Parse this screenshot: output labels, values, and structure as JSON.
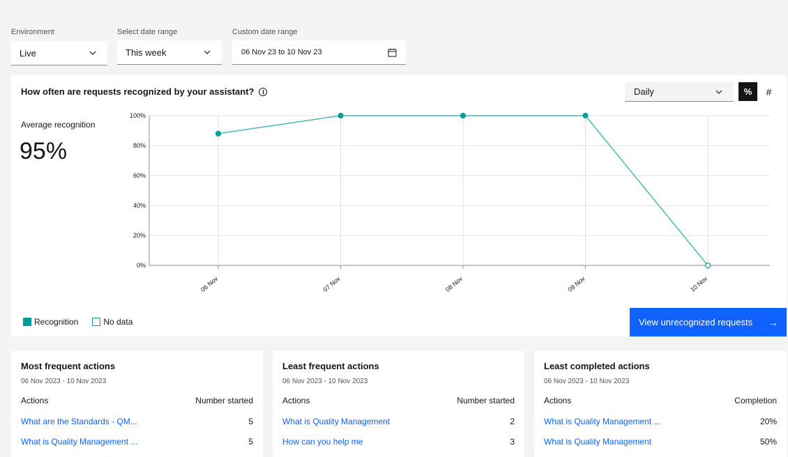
{
  "filters": {
    "environment_label": "Environment",
    "environment_value": "Live",
    "date_range_label": "Select date range",
    "date_range_value": "This week",
    "custom_label": "Custom date range",
    "custom_value": "06 Nov 23 to 10 Nov 23"
  },
  "recognition": {
    "title": "How often are requests recognized by your assistant?",
    "period": "Daily",
    "toggle_percent": "%",
    "toggle_count": "#",
    "avg_label": "Average recognition",
    "avg_value": "95%",
    "legend_recognition": "Recognition",
    "legend_nodata": "No data",
    "view_button": "View unrecognized requests",
    "arrow": "→"
  },
  "chart_data": {
    "type": "line",
    "categories": [
      "06 Nov",
      "07 Nov",
      "08 Nov",
      "09 Nov",
      "10 Nov"
    ],
    "series": [
      {
        "name": "Recognition",
        "values": [
          88,
          100,
          100,
          100,
          0
        ]
      }
    ],
    "no_data": [
      false,
      false,
      false,
      false,
      true
    ],
    "yticks": [
      "0%",
      "20%",
      "40%",
      "60%",
      "80%",
      "100%"
    ],
    "ylim": [
      0,
      100
    ],
    "color": "#009d9a",
    "grid": true
  },
  "action_cards": [
    {
      "title": "Most frequent actions",
      "date": "06 Nov 2023 - 10 Nov 2023",
      "col1": "Actions",
      "col2": "Number started",
      "rows": [
        {
          "action": "What are the Standards - QM...",
          "value": "5"
        },
        {
          "action": "What is Quality Management ...",
          "value": "5"
        }
      ]
    },
    {
      "title": "Least frequent actions",
      "date": "06 Nov 2023 - 10 Nov 2023",
      "col1": "Actions",
      "col2": "Number started",
      "rows": [
        {
          "action": "What is Quality Management",
          "value": "2"
        },
        {
          "action": "How can you help me",
          "value": "3"
        }
      ]
    },
    {
      "title": "Least completed actions",
      "date": "06 Nov 2023 - 10 Nov 2023",
      "col1": "Actions",
      "col2": "Completion",
      "rows": [
        {
          "action": "What is Quality Management ...",
          "value": "20%"
        },
        {
          "action": "What is Quality Management",
          "value": "50%"
        }
      ]
    }
  ]
}
